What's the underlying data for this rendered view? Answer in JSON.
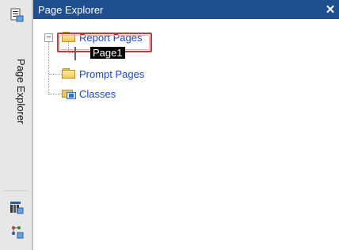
{
  "left_toolbar": {
    "vertical_label": "Page Explorer"
  },
  "panel": {
    "title": "Page Explorer",
    "close_glyph": "✕"
  },
  "tree": {
    "items": [
      {
        "label": "Report Pages",
        "expanded": true,
        "expander_glyph": "−",
        "icon": "folder-icon"
      },
      {
        "label": "Page1",
        "icon": "page-icon",
        "selected": true
      },
      {
        "label": "Prompt Pages",
        "icon": "folder-icon"
      },
      {
        "label": "Classes",
        "icon": "classes-icon"
      }
    ]
  },
  "colors": {
    "titlebar": "#1f4f8e",
    "link_text": "#1a47d6",
    "highlight": "#c0393b"
  }
}
